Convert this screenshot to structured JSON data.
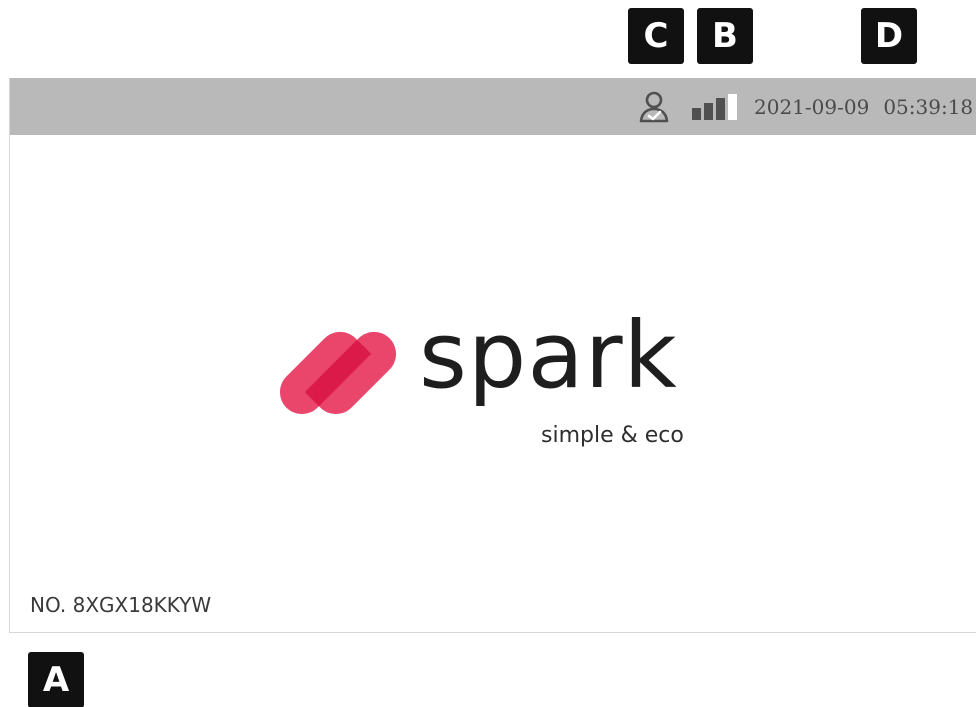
{
  "callouts": {
    "a": "A",
    "b": "B",
    "c": "C",
    "d": "D"
  },
  "status_bar": {
    "user_icon": "user-check-icon",
    "signal_icon": "signal-strength-icon",
    "signal_level_bars": 3,
    "signal_total_bars": 4,
    "date": "2021-09-09",
    "time": "05:39:18"
  },
  "logo": {
    "brand": "spark",
    "tagline": "simple & eco",
    "mark_icon": "spark-logo-icon"
  },
  "serial_number": "NO. 8XGX18KKYW",
  "colors": {
    "status_bar_bg": "#b9b9b9",
    "brand_pink": "#e8365f",
    "brand_pink_dark": "#dc1d4d",
    "text_dark": "#1e1e1e",
    "callout_bg": "#111111"
  }
}
